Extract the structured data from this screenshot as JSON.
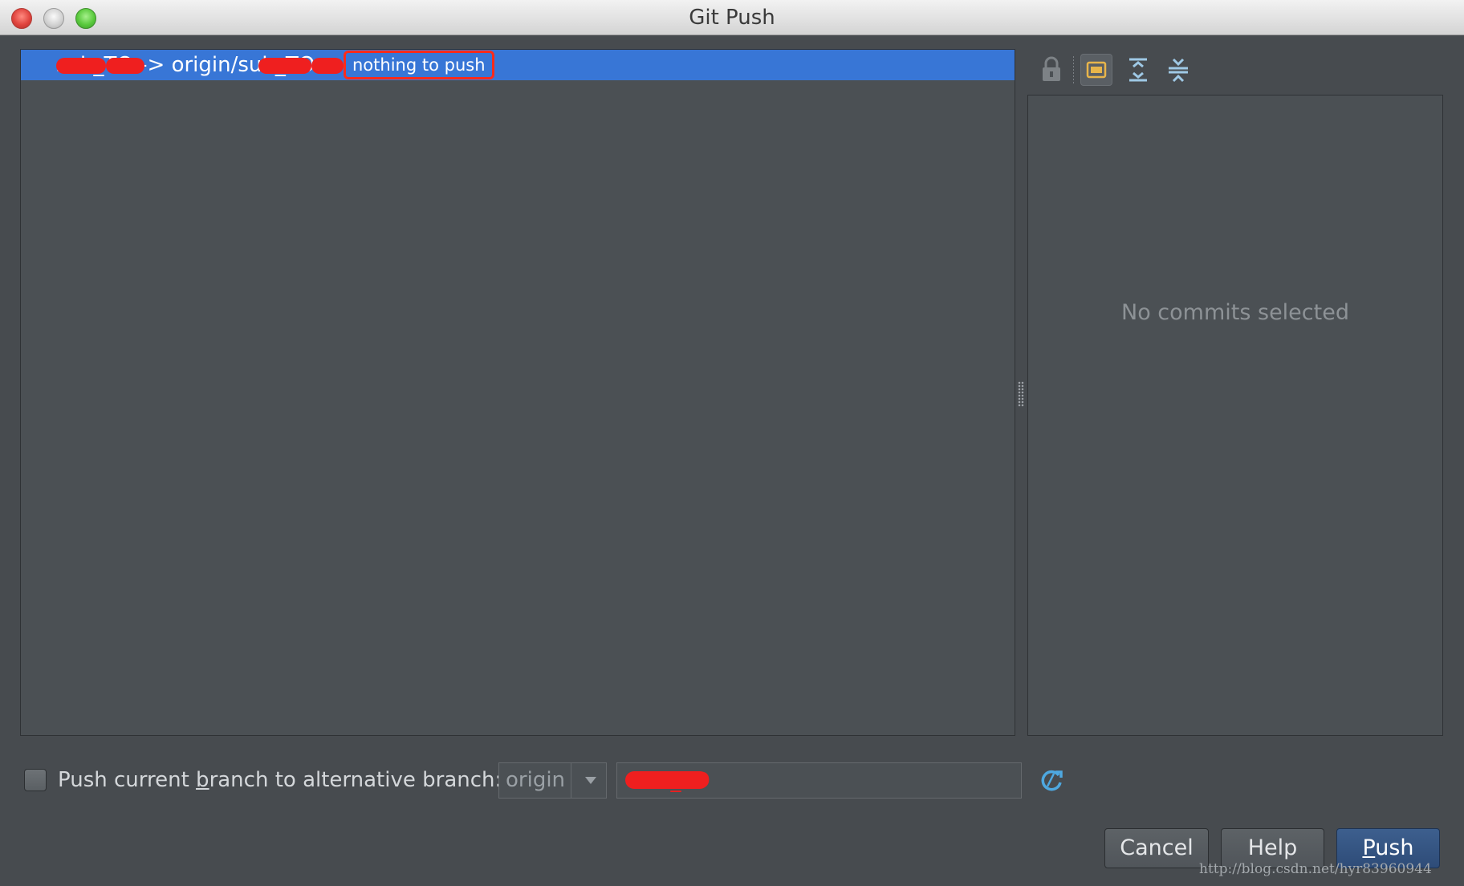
{
  "window": {
    "title": "Git Push"
  },
  "tree": {
    "row": {
      "branch_spec": "sub_TO -> origin/sub_TO",
      "status": "nothing to push"
    }
  },
  "details": {
    "empty_text": "No commits selected"
  },
  "toolbar": {
    "icons": [
      "lock-icon",
      "layout-icon",
      "expand-all-icon",
      "collapse-all-icon"
    ]
  },
  "alternative": {
    "label_prefix": "Push current ",
    "label_mnemonic": "b",
    "label_suffix": "ranch to alternative branch:",
    "remote_value": "origin",
    "branch_value": "sub_TO",
    "checked": false
  },
  "buttons": {
    "cancel": "Cancel",
    "help": "Help",
    "push_mnemonic": "P",
    "push_rest": "ush"
  },
  "watermark": "http://blog.csdn.net/hyr83960944",
  "colors": {
    "selection": "#3876d6",
    "highlight_box": "#ff2a1a",
    "redaction": "#ef1f1f",
    "push_button": "#2e4c78"
  }
}
